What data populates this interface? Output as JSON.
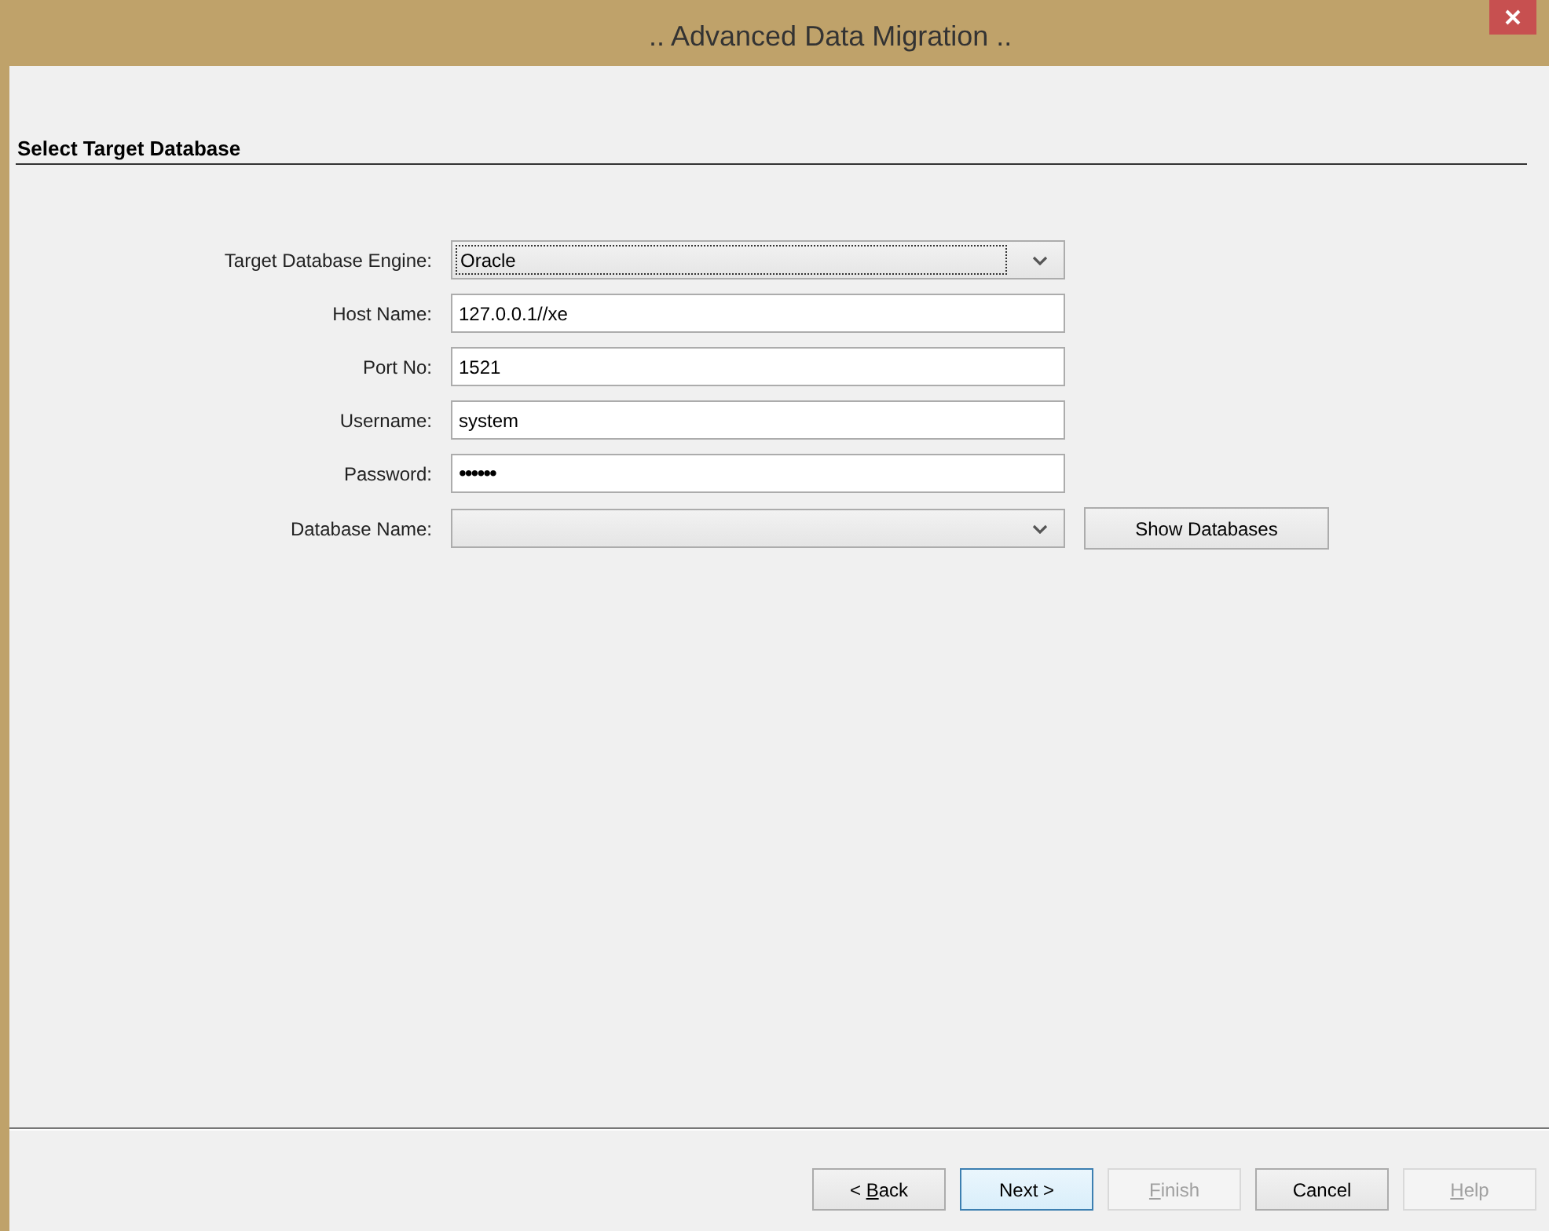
{
  "window": {
    "title": ".. Advanced Data Migration .."
  },
  "section_title": "Select Target Database",
  "fields": [
    {
      "kind": "combo",
      "label": "Target Database Engine:",
      "value": "Oracle",
      "focused": true
    },
    {
      "kind": "text",
      "label": "Host Name:",
      "value": "127.0.0.1//xe"
    },
    {
      "kind": "text",
      "label": "Port No:",
      "value": "1521"
    },
    {
      "kind": "text",
      "label": "Username:",
      "value": "system"
    },
    {
      "kind": "password",
      "label": "Password:",
      "value": "••••••"
    },
    {
      "kind": "combo",
      "label": "Database Name:",
      "focused": false,
      "button": "Show Databases"
    }
  ],
  "buttons": [
    {
      "label_parts": [
        "< ",
        "B",
        "ack"
      ],
      "disabled": false,
      "default": false
    },
    {
      "label_parts": [
        "Next >"
      ],
      "disabled": false,
      "default": true
    },
    {
      "label_parts": [
        "F",
        "inish"
      ],
      "disabled": true,
      "default": false
    },
    {
      "label_parts": [
        "Cancel"
      ],
      "disabled": false,
      "default": false
    },
    {
      "label_parts": [
        "H",
        "elp"
      ],
      "disabled": true,
      "default": false
    }
  ]
}
